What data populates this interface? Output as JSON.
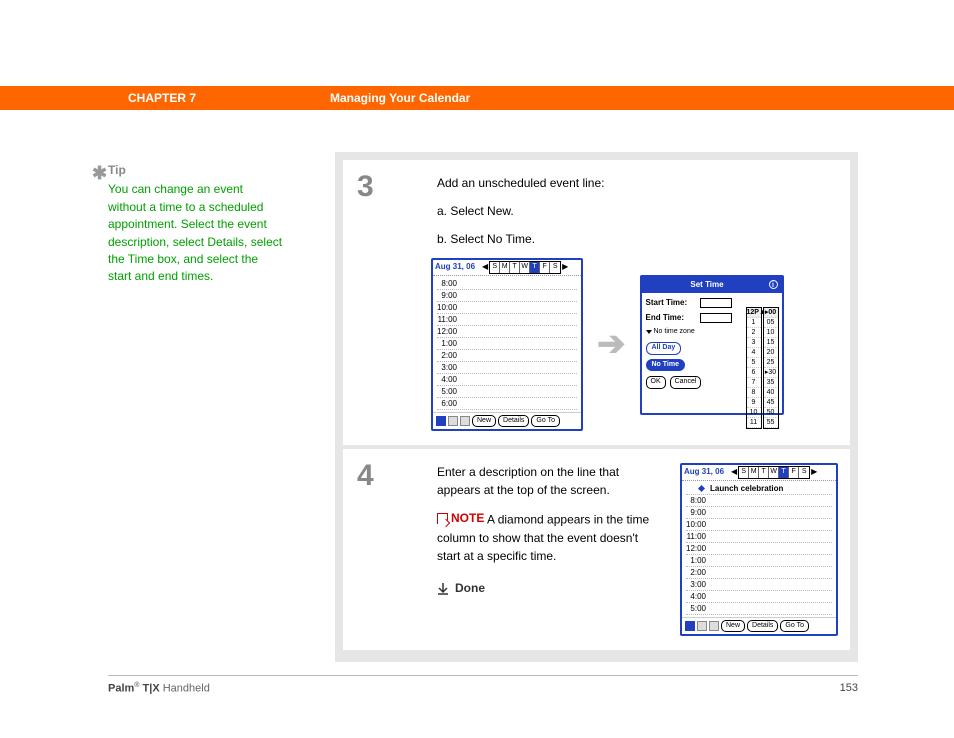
{
  "header": {
    "chapter": "CHAPTER 7",
    "title": "Managing Your Calendar"
  },
  "tip": {
    "label": "Tip",
    "text": "You can change an event without a time to a scheduled appointment. Select the event description, select Details, select the Time box, and select the start and end times."
  },
  "step3": {
    "number": "3",
    "intro": "Add an unscheduled event line:",
    "itemA": "a.  Select New.",
    "itemB": "b.  Select No Time."
  },
  "dayview": {
    "date": "Aug 31, 06",
    "days": [
      "S",
      "M",
      "T",
      "W",
      "T",
      "F",
      "S"
    ],
    "times": [
      "8:00",
      "9:00",
      "10:00",
      "11:00",
      "12:00",
      "1:00",
      "2:00",
      "3:00",
      "4:00",
      "5:00",
      "6:00"
    ],
    "buttons": {
      "new": "New",
      "details": "Details",
      "goto": "Go To"
    }
  },
  "settime": {
    "title": "Set Time",
    "startLabel": "Start Time:",
    "endLabel": "End Time:",
    "noTimeZone": "No time zone",
    "allDay": "All Day",
    "noTime": "No Time",
    "ok": "OK",
    "cancel": "Cancel",
    "hoursHeader": "12P▲",
    "hours": [
      "1",
      "2",
      "3",
      "4",
      "5",
      "6",
      "7",
      "8",
      "9",
      "10",
      "11"
    ],
    "minsHeader": "▸00",
    "mins": [
      "05",
      "10",
      "15",
      "20",
      "25",
      "▸30",
      "35",
      "40",
      "45",
      "50",
      "55"
    ]
  },
  "step4": {
    "number": "4",
    "text": "Enter a description on the line that appears at the top of the screen.",
    "noteLabel": "NOTE",
    "noteText": " A diamond appears in the time column to show that the event doesn't start at a specific time.",
    "done": "Done"
  },
  "dayview2": {
    "date": "Aug 31, 06",
    "event": "Launch celebration",
    "times": [
      "8:00",
      "9:00",
      "10:00",
      "11:00",
      "12:00",
      "1:00",
      "2:00",
      "3:00",
      "4:00",
      "5:00"
    ]
  },
  "footer": {
    "brand": "Palm",
    "model": " T|X",
    "suffix": " Handheld",
    "page": "153"
  }
}
